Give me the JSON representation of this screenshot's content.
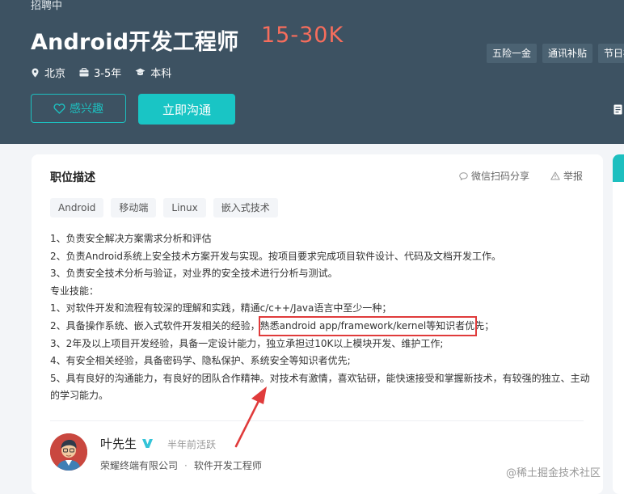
{
  "header": {
    "status": "招聘中",
    "title": "Android开发工程师",
    "salary": "15-30K",
    "meta": [
      {
        "icon": "location-icon",
        "text": "北京"
      },
      {
        "icon": "briefcase-icon",
        "text": "3-5年"
      },
      {
        "icon": "graduation-cap-icon",
        "text": "本科"
      }
    ],
    "benefits": [
      "五险一金",
      "通讯补贴",
      "节日福"
    ],
    "interest_label": "感兴趣",
    "chat_label": "立即沟通"
  },
  "card": {
    "title": "职位描述",
    "share_label": "微信扫码分享",
    "report_label": "举报",
    "tags": [
      "Android",
      "移动端",
      "Linux",
      "嵌入式技术"
    ],
    "lines": [
      "1、负责安全解决方案需求分析和评估",
      "2、负责Android系统上安全技术方案开发与实现。按项目要求完成项目软件设计、代码及文档开发工作。",
      "3、负责安全技术分析与验证，对业界的安全技术进行分析与测试。",
      "专业技能：",
      "1、对软件开发和流程有较深的理解和实践，精通c/c++/Java语言中至少一种；",
      "2、具备操作系统、嵌入式软件开发相关的经验，熟悉android app/framework/kernel等知识者优先；",
      "3、2年及以上项目开发经验，具备一定设计能力，独立承担过10K以上模块开发、维护工作;",
      "4、有安全相关经验，具备密码学、隐私保护、系统安全等知识者优先;",
      "5、具有良好的沟通能力，有良好的团队合作精神。对技术有激情，喜欢钻研，能快速接受和掌握新技术，有较强的独立、主动的学习能力。"
    ]
  },
  "recruiter": {
    "name": "叶先生",
    "active": "半年前活跃",
    "company": "荣耀终端有限公司",
    "separator": "·",
    "position": "软件开发工程师"
  },
  "watermark": "@稀土掘金技术社区",
  "colors": {
    "header_bg": "#3d5262",
    "accent": "#19c5c5",
    "salary": "#f76d5c",
    "annotation_red": "#e03b3b"
  }
}
